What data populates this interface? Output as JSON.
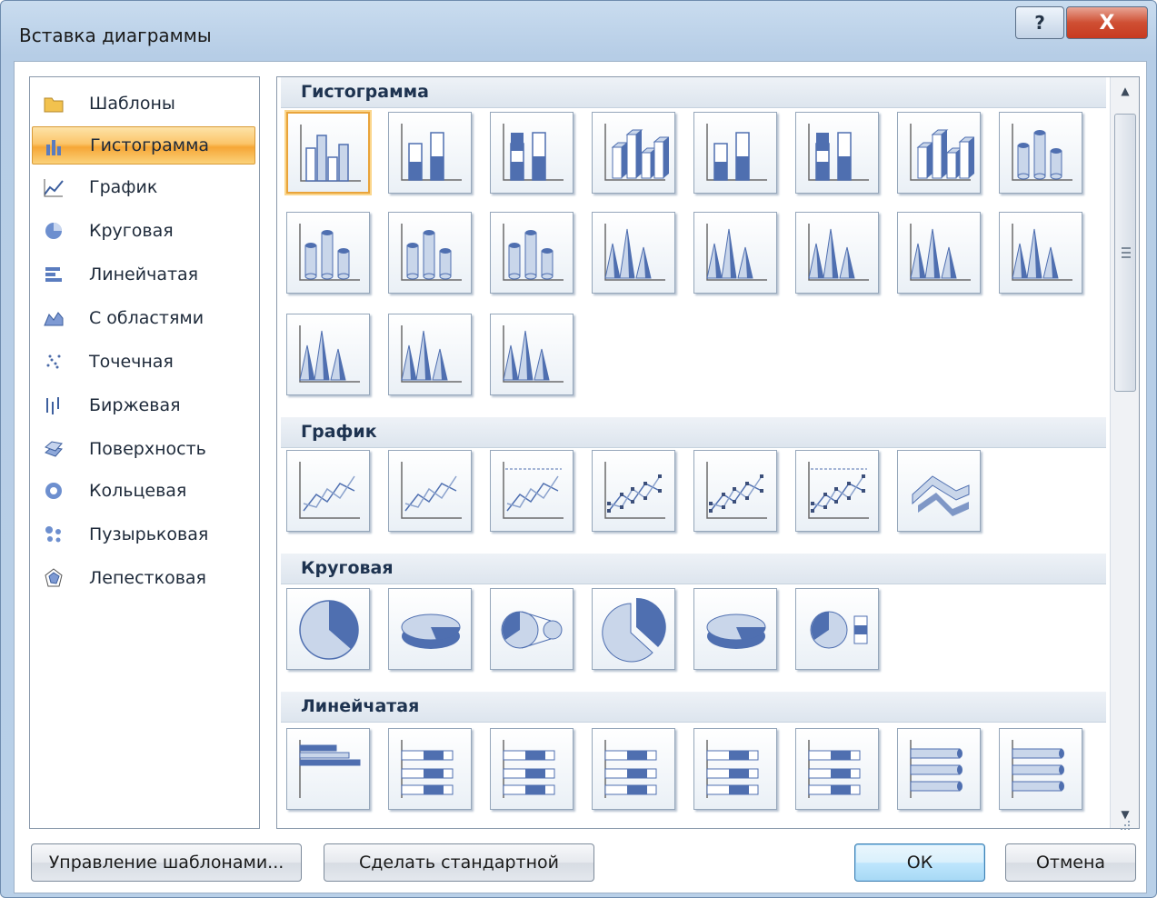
{
  "window": {
    "title": "Вставка диаграммы",
    "help_label": "?",
    "close_label": "X"
  },
  "categories": [
    {
      "label": "Шаблоны",
      "icon": "folder-icon"
    },
    {
      "label": "Гистограмма",
      "icon": "column-chart-icon",
      "selected": true
    },
    {
      "label": "График",
      "icon": "line-chart-icon"
    },
    {
      "label": "Круговая",
      "icon": "pie-chart-icon"
    },
    {
      "label": "Линейчатая",
      "icon": "bar-chart-icon"
    },
    {
      "label": "С областями",
      "icon": "area-chart-icon"
    },
    {
      "label": "Точечная",
      "icon": "scatter-chart-icon"
    },
    {
      "label": "Биржевая",
      "icon": "stock-chart-icon"
    },
    {
      "label": "Поверхность",
      "icon": "surface-chart-icon"
    },
    {
      "label": "Кольцевая",
      "icon": "doughnut-chart-icon"
    },
    {
      "label": "Пузырьковая",
      "icon": "bubble-chart-icon"
    },
    {
      "label": "Лепестковая",
      "icon": "radar-chart-icon"
    }
  ],
  "sections": [
    {
      "title": "Гистограмма",
      "thumbnails": [
        "column",
        "stacked-column",
        "percent-column",
        "column-3d",
        "stacked-column-3d",
        "percent-column-3d",
        "column-3d-depth",
        "cylinder",
        "stacked-cylinder",
        "percent-cylinder",
        "cylinder-3d",
        "cone",
        "stacked-cone",
        "percent-cone",
        "cone-3d",
        "pyramid",
        "stacked-pyramid",
        "percent-pyramid",
        "pyramid-3d"
      ]
    },
    {
      "title": "График",
      "thumbnails": [
        "line",
        "stacked-line",
        "percent-line",
        "line-markers",
        "stacked-line-markers",
        "percent-line-markers",
        "line-3d"
      ]
    },
    {
      "title": "Круговая",
      "thumbnails": [
        "pie",
        "pie-3d",
        "pie-of-pie",
        "exploded-pie",
        "exploded-pie-3d",
        "bar-of-pie"
      ]
    },
    {
      "title": "Линейчатая",
      "thumbnails": [
        "bar",
        "stacked-bar",
        "percent-bar",
        "bar-3d",
        "stacked-bar-3d",
        "percent-bar-3d",
        "cylinder-bar",
        "stacked-cylinder-bar"
      ]
    }
  ],
  "buttons": {
    "manage_templates": "Управление шаблонами...",
    "set_default": "Сделать стандартной",
    "ok": "ОК",
    "cancel": "Отмена"
  },
  "colors": {
    "accent": "#f6a636",
    "chart_fill": "#4f6fb0",
    "chart_light": "#c9d6ea"
  }
}
